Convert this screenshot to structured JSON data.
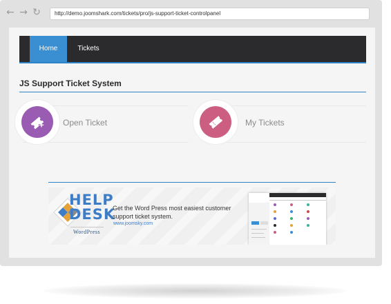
{
  "browser": {
    "url": "http://demo.joomshark.com/tickets/pro/js-support-ticket-controlpanel",
    "back_icon": "arrow-left-icon",
    "forward_icon": "arrow-right-icon",
    "reload_icon": "reload-icon"
  },
  "nav": {
    "items": [
      {
        "label": "Home",
        "active": true
      },
      {
        "label": "Tickets",
        "active": false
      }
    ]
  },
  "page": {
    "title": "JS Support Ticket System"
  },
  "cards": [
    {
      "label": "Open Ticket",
      "icon": "ticket-plus-icon",
      "color": "#9a5bb3"
    },
    {
      "label": "My Tickets",
      "icon": "ticket-icon",
      "color": "#cc5e82"
    }
  ],
  "banner": {
    "help": "HELP",
    "desk": "DESK",
    "wordpress": "WordPress",
    "headline": "Get the Word Press most easiest customer support ticket system.",
    "url": "www.joomsky.com"
  },
  "colors": {
    "accent": "#3a8ed2",
    "nav_bg": "#2b2b2e",
    "rule": "#2d83c5"
  }
}
